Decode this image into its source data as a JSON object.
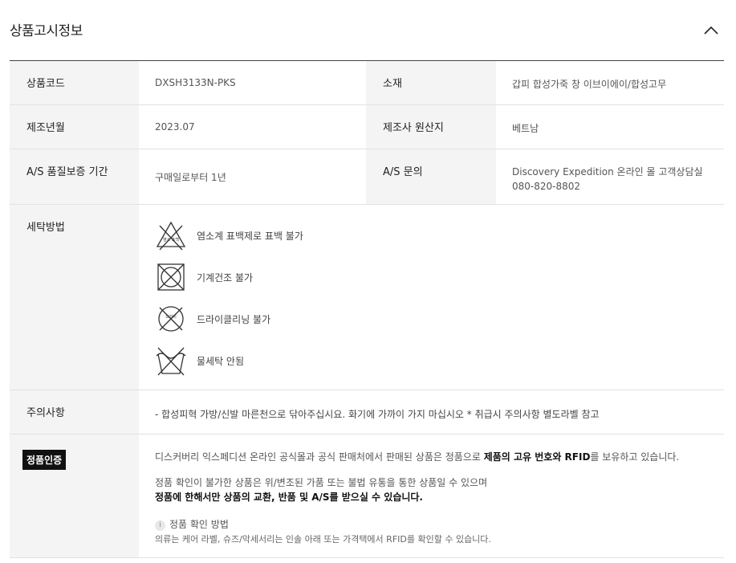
{
  "header": {
    "title": "상품고시정보"
  },
  "spec": {
    "code_label": "상품코드",
    "code_value": "DXSH3133N-PKS",
    "material_label": "소재",
    "material_value": "갑피 합성가죽 창 이브이에이/합성고무",
    "date_label": "제조년월",
    "date_value": "2023.07",
    "origin_label": "제조사 원산지",
    "origin_value": "베트남",
    "warranty_label": "A/S 품질보증 기간",
    "warranty_value": "구매일로부터 1년",
    "as_label": "A/S 문의",
    "as_value_line1": "Discovery Expedition 온라인 몰 고객상담실",
    "as_value_line2": "080-820-8802"
  },
  "washing": {
    "label": "세탁방법",
    "bleach_icon_text": "염소 표백",
    "dryclean_icon_text": "드라이",
    "items": [
      "염소계 표백제로 표백 불가",
      "기계건조 불가",
      "드라이클리닝 불가",
      "물세탁 안됨"
    ]
  },
  "caution": {
    "label": "주의사항",
    "text": "-  합성피혁 가방/신발 마른천으로 닦아주십시요. 화기에 가까이 가지 마십시오 * 취급시 주의사항 별도라벨 참고"
  },
  "genuine": {
    "badge": "정품인증",
    "line1_pre": "디스커버리 익스페디션 온라인 공식몰과 공식 판매처에서 판매된 상품은 정품으로 ",
    "line1_bold": "제품의 고유 번호와 RFID",
    "line1_post": "를 보유하고 있습니다.",
    "line2": "정품 확인이 불가한 상품은 위/변조된 가품 또는 불법 유통을 통한 상품일 수 있으며",
    "line3": "정품에 한해서만 상품의 교환, 반품 및 A/S를 받으실 수 있습니다.",
    "method_icon": "i",
    "method_title": "정품 확인 방법",
    "method_text": "의류는 케어 라벨, 슈즈/악세서리는 인솔 아래 또는 가격택에서 RFID를 확인할 수 있습니다."
  }
}
